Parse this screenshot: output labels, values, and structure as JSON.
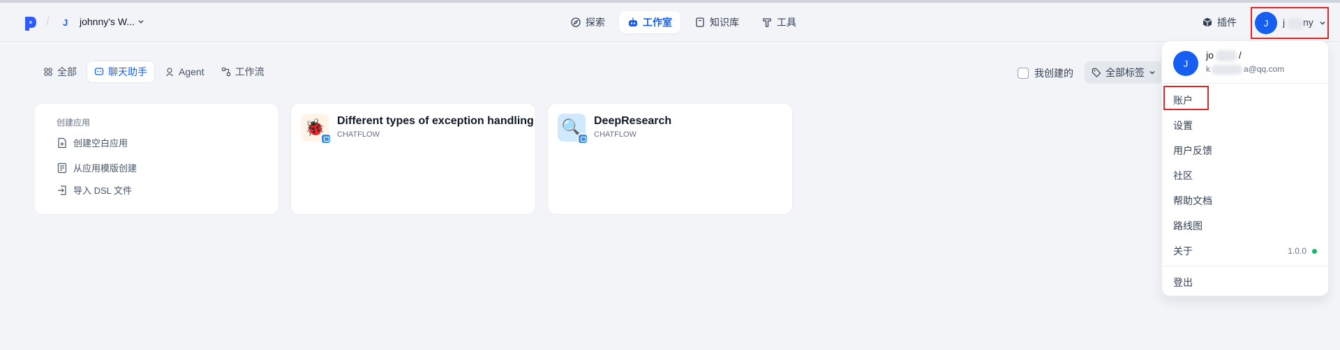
{
  "header": {
    "workspace_icon": "J",
    "workspace_name": "johnny's W...",
    "nav": [
      {
        "label": "探索",
        "icon": "compass-icon"
      },
      {
        "label": "工作室",
        "icon": "robot-icon",
        "active": true
      },
      {
        "label": "知识库",
        "icon": "book-icon"
      },
      {
        "label": "工具",
        "icon": "hammer-icon"
      }
    ],
    "plugins_label": "插件",
    "user_initial": "J",
    "user_name_visible_start": "j",
    "user_name_visible_end": "ny"
  },
  "filters": {
    "tabs": [
      {
        "label": "全部",
        "icon": "grid-icon"
      },
      {
        "label": "聊天助手",
        "icon": "chat-icon",
        "active": true
      },
      {
        "label": "Agent",
        "icon": "agent-icon"
      },
      {
        "label": "工作流",
        "icon": "workflow-icon"
      }
    ],
    "mine_label": "我创建的",
    "tags_label": "全部标签"
  },
  "create_card": {
    "title": "创建应用",
    "items": [
      "创建空白应用",
      "从应用模版创建",
      "导入 DSL 文件"
    ]
  },
  "apps": [
    {
      "name": "Different types of exception handling",
      "type": "CHATFLOW",
      "icon": "bug-icon"
    },
    {
      "name": "DeepResearch",
      "type": "CHATFLOW",
      "icon": "magnifier-icon"
    }
  ],
  "dropdown": {
    "avatar_initial": "J",
    "name_start": "jo",
    "name_end": "/",
    "email_start": "k",
    "email_end": "a@qq.com",
    "items": [
      "账户",
      "设置",
      "用户反馈",
      "社区",
      "帮助文档",
      "路线图",
      "关于"
    ],
    "version": "1.0.0",
    "logout": "登出"
  },
  "colors": {
    "accent": "#155eef",
    "highlight_border": "#e02424",
    "status_ok": "#12b76a"
  }
}
